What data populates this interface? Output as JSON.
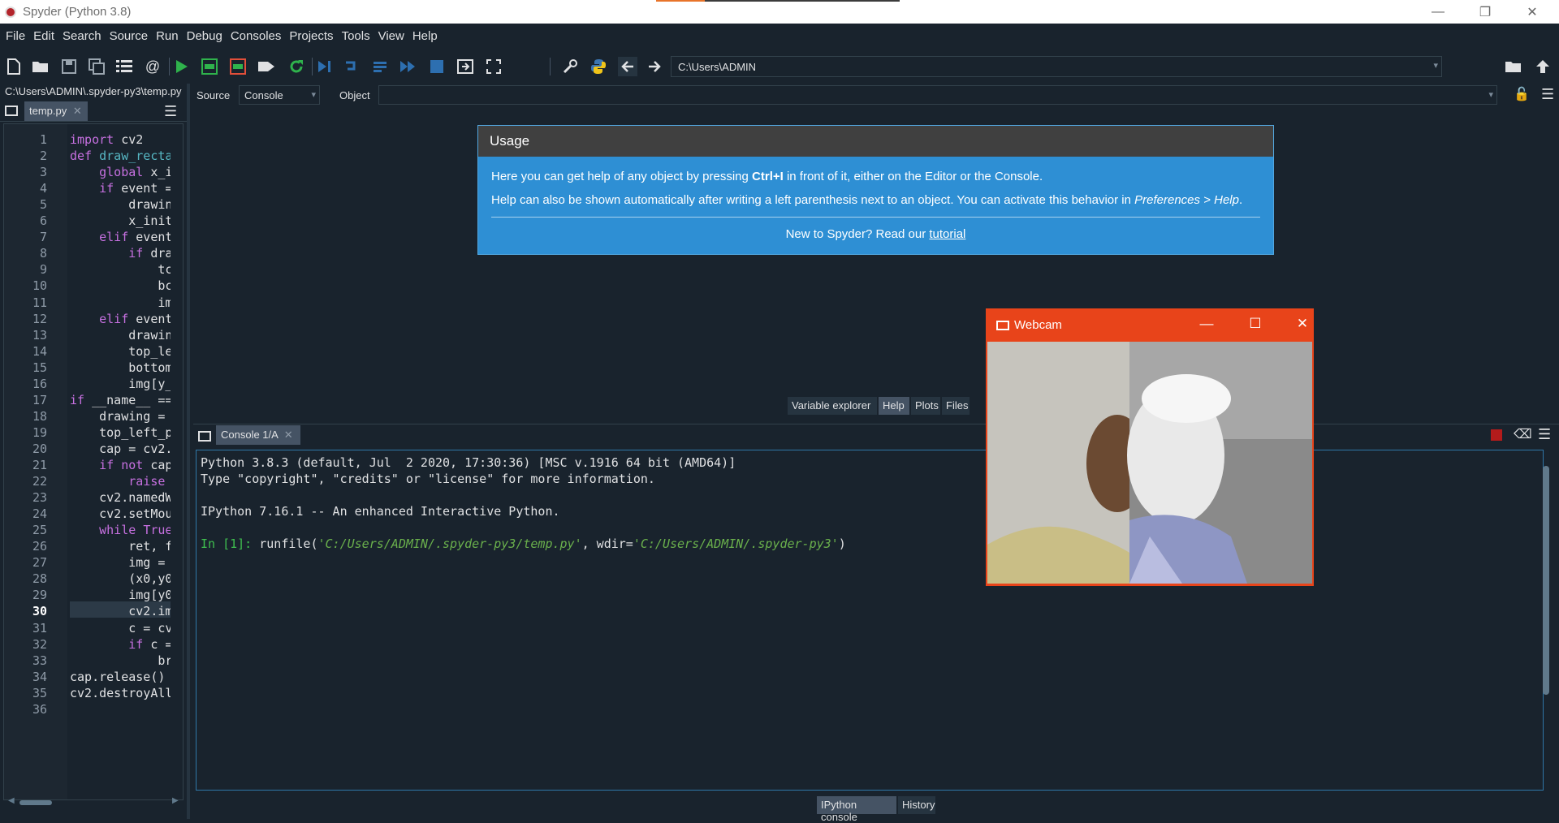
{
  "window": {
    "title": "Spyder (Python 3.8)",
    "minimize": "—",
    "restore": "❐",
    "close": "✕"
  },
  "menu": [
    "File",
    "Edit",
    "Search",
    "Source",
    "Run",
    "Debug",
    "Consoles",
    "Projects",
    "Tools",
    "View",
    "Help"
  ],
  "toolbar": {
    "working_dir": "C:\\Users\\ADMIN"
  },
  "editor": {
    "file_path": "C:\\Users\\ADMIN\\.spyder-py3\\temp.py",
    "tab_label": "temp.py",
    "current_line": 30,
    "line_numbers": [
      "1",
      "2",
      "3",
      "4",
      "5",
      "6",
      "7",
      "8",
      "9",
      "10",
      "11",
      "12",
      "13",
      "14",
      "15",
      "16",
      "17",
      "18",
      "19",
      "20",
      "21",
      "22",
      "23",
      "24",
      "25",
      "26",
      "27",
      "28",
      "29",
      "30",
      "31",
      "32",
      "33",
      "34",
      "35",
      "36"
    ],
    "lines": [
      "import cv2",
      "def draw_recta",
      "    global x_i",
      "    if event =",
      "        drawin",
      "        x_init",
      "    elif event",
      "        if dra",
      "            tc",
      "            bc",
      "            im",
      "    elif event",
      "        drawin",
      "        top_le",
      "        bottom",
      "        img[y_",
      "if __name__ ==",
      "    drawing = ",
      "    top_left_p",
      "    cap = cv2.",
      "    if not cap",
      "        raise ",
      "    cv2.namedW",
      "    cv2.setMou",
      "    while True",
      "        ret, f",
      "        img = ",
      "        (x0,y0",
      "        img[y0",
      "        cv2.im",
      "        c = cv",
      "        if c =",
      "            br",
      "cap.release()",
      "cv2.destroyAll",
      ""
    ]
  },
  "help": {
    "source_label": "Source",
    "source_value": "Console",
    "object_label": "Object",
    "usage_title": "Usage",
    "usage_line1_a": "Here you can get help of any object by pressing ",
    "usage_line1_b": "Ctrl+I",
    "usage_line1_c": " in front of it, either on the Editor or the Console.",
    "usage_line2_a": "Help can also be shown automatically after writing a left parenthesis next to an object. You can activate this behavior in ",
    "usage_line2_b": "Preferences > Help",
    "usage_line2_c": ".",
    "usage_line3_a": "New to Spyder? Read our ",
    "usage_line3_link": "tutorial",
    "tabs": [
      "Variable explorer",
      "Help",
      "Plots",
      "Files"
    ],
    "active_tab": "Help"
  },
  "console": {
    "tab_label": "Console 1/A",
    "line1": "Python 3.8.3 (default, Jul  2 2020, 17:30:36) [MSC v.1916 64 bit (AMD64)]",
    "line2": "Type \"copyright\", \"credits\" or \"license\" for more information.",
    "line3": "IPython 7.16.1 -- An enhanced Interactive Python.",
    "prompt": "In [1]: ",
    "cmd_a": "runfile(",
    "cmd_str1": "'C:/Users/ADMIN/.spyder-py3/temp.py'",
    "cmd_b": ", wdir=",
    "cmd_str2": "'C:/Users/ADMIN/.spyder-py3'",
    "cmd_c": ")",
    "bottom_tabs": [
      "IPython console",
      "History"
    ],
    "active_tab": "IPython console"
  },
  "webcam": {
    "title": "Webcam",
    "minimize": "—",
    "maximize": "☐",
    "close": "✕"
  },
  "colors": {
    "background": "#19232d",
    "usage_panel": "#2e8fd4",
    "webcam_titlebar": "#e8441a",
    "prompt_green": "#3fbf4f"
  }
}
